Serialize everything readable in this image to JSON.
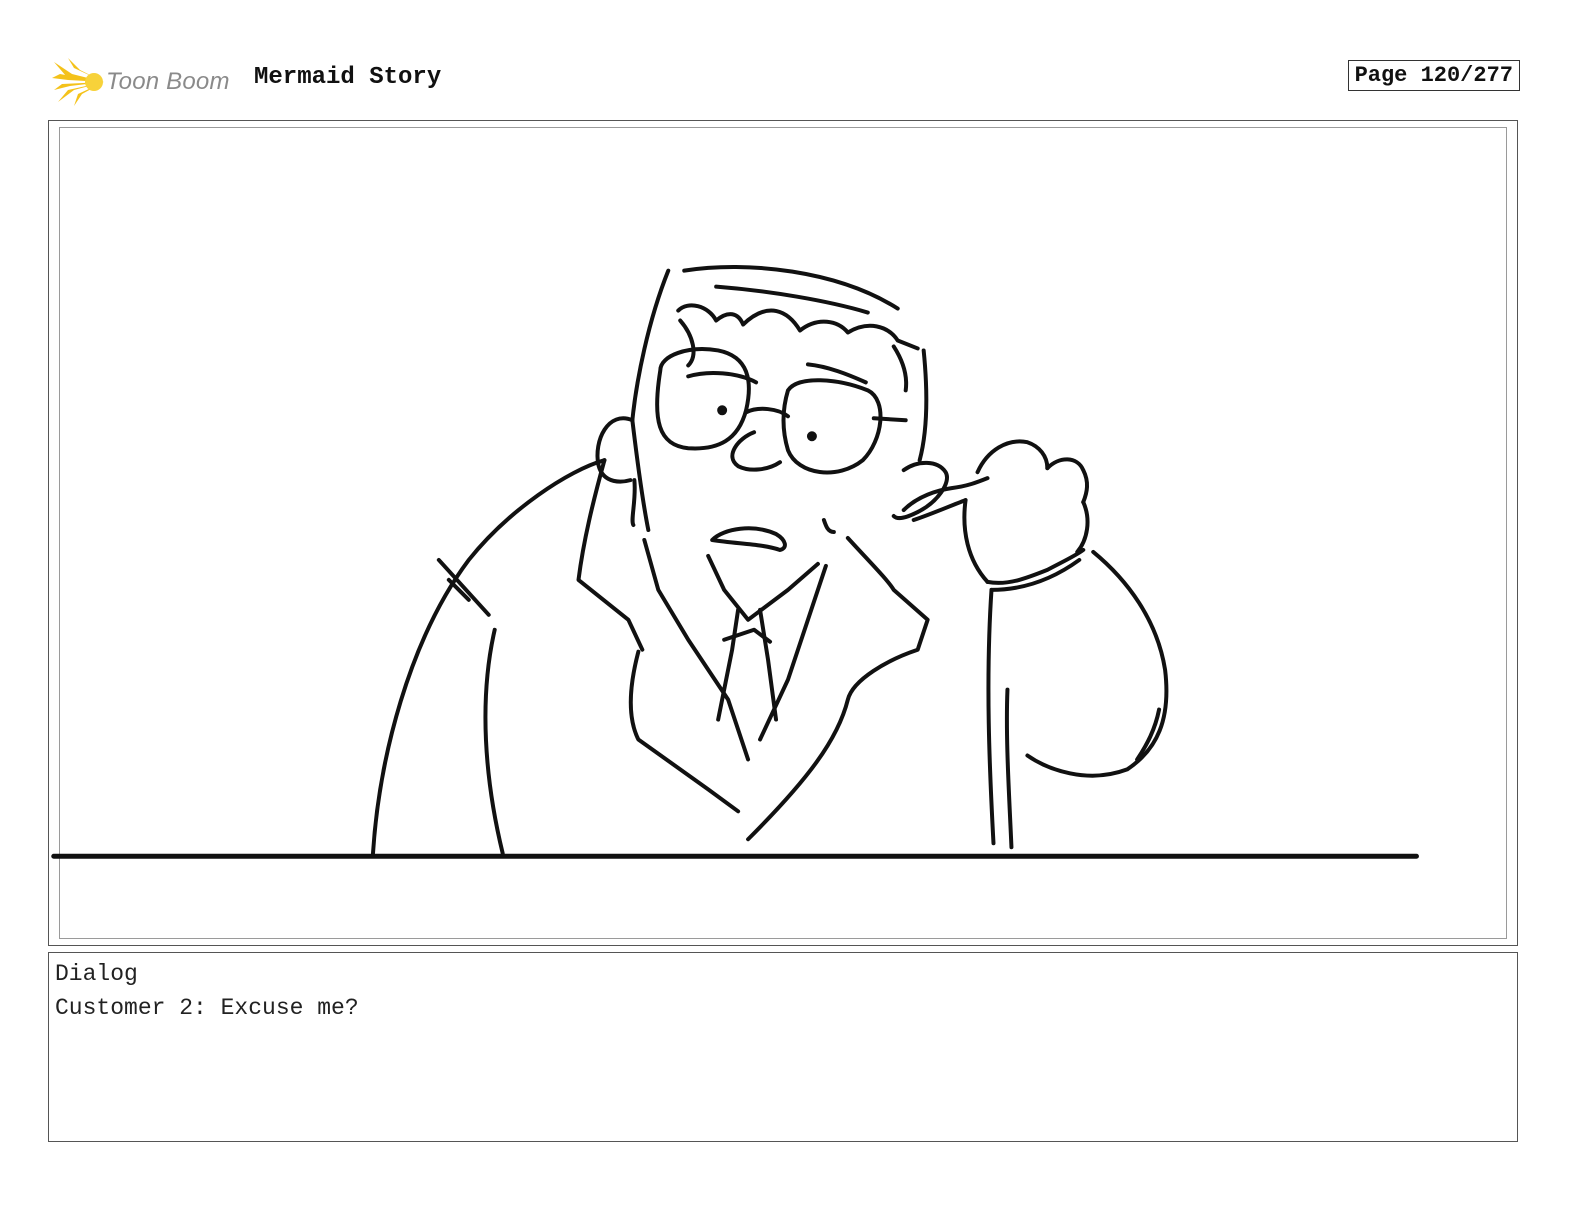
{
  "header": {
    "logo_text": "Toon Boom",
    "project_title": "Mermaid Story",
    "page_indicator": "Page 120/277"
  },
  "panel": {
    "icon": "storyboard-sketch-man-with-glasses-finger-in-ear"
  },
  "dialog": {
    "label": "Dialog",
    "line": "Customer 2: Excuse me?"
  },
  "colors": {
    "logo_accent": "#f4c21a",
    "logo_text": "#8a8a8a",
    "ink": "#111111"
  }
}
